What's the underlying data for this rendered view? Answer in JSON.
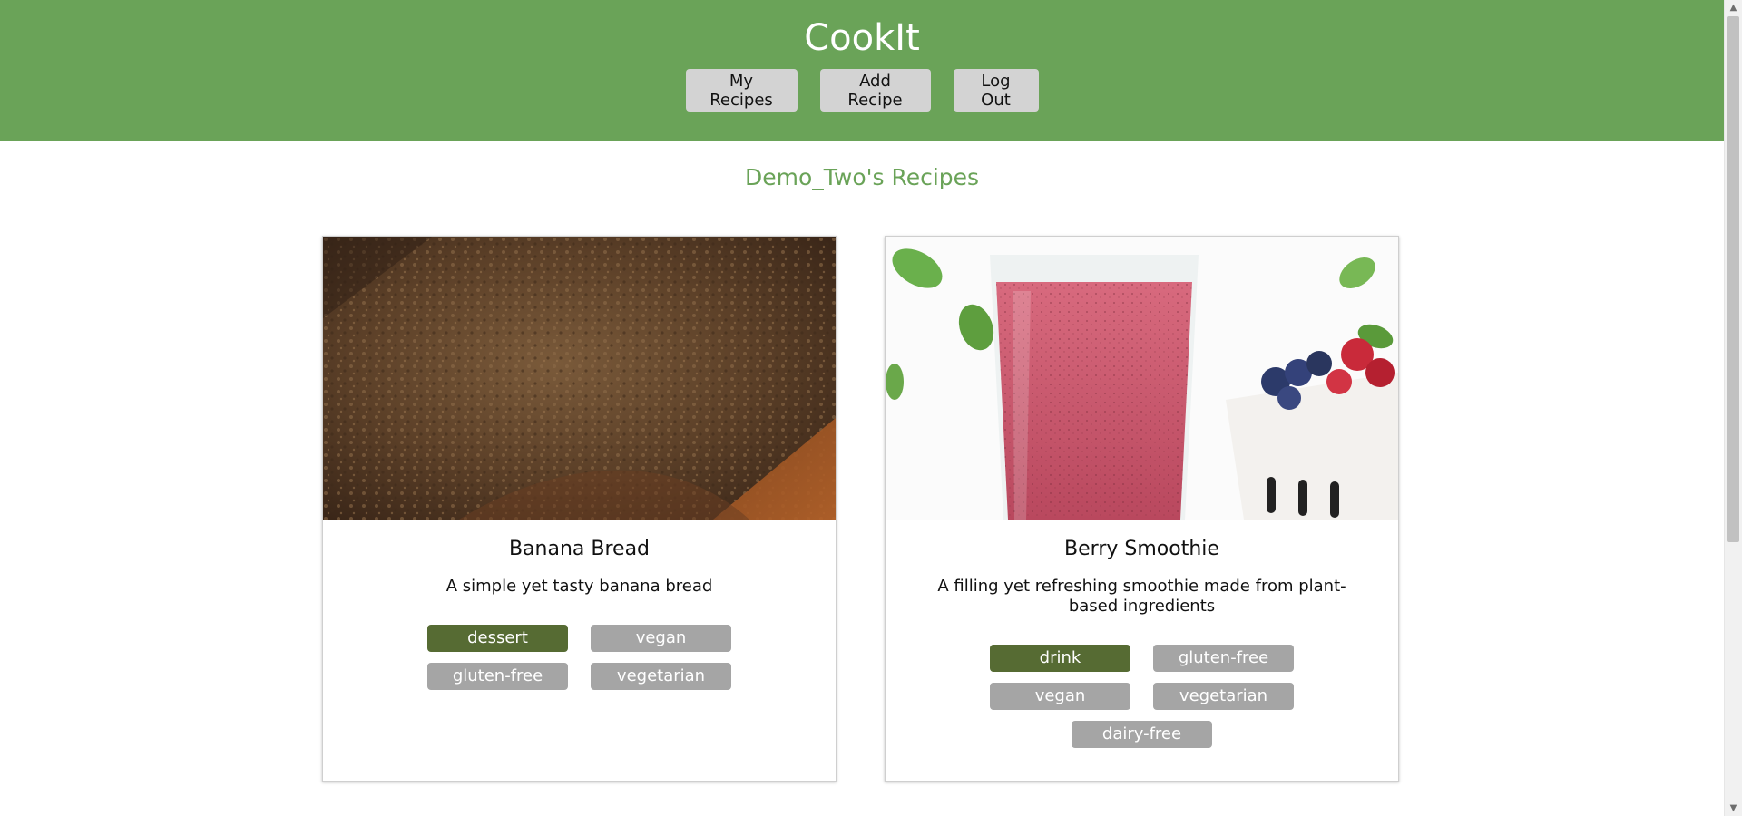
{
  "app": {
    "title": "CookIt"
  },
  "nav": {
    "my_recipes": "My Recipes",
    "add_recipe": "Add Recipe",
    "log_out": "Log Out"
  },
  "page": {
    "heading": "Demo_Two's Recipes"
  },
  "recipes": [
    {
      "title": "Banana Bread",
      "description": "A simple yet tasty banana bread",
      "image": "banana-bread-photo",
      "tags": [
        {
          "label": "dessert",
          "primary": true
        },
        {
          "label": "vegan",
          "primary": false
        },
        {
          "label": "gluten-free",
          "primary": false
        },
        {
          "label": "vegetarian",
          "primary": false
        }
      ]
    },
    {
      "title": "Berry Smoothie",
      "description": "A filling yet refreshing smoothie made from plant-based ingredients",
      "image": "berry-smoothie-photo",
      "tags": [
        {
          "label": "drink",
          "primary": true
        },
        {
          "label": "gluten-free",
          "primary": false
        },
        {
          "label": "vegan",
          "primary": false
        },
        {
          "label": "vegetarian",
          "primary": false
        },
        {
          "label": "dairy-free",
          "primary": false
        }
      ]
    }
  ],
  "colors": {
    "header_bg": "#6aa358",
    "heading_text": "#6aa358",
    "tag_primary": "#566b33",
    "tag_secondary": "#a5a5a5",
    "nav_button_bg": "#d3d3d3"
  }
}
